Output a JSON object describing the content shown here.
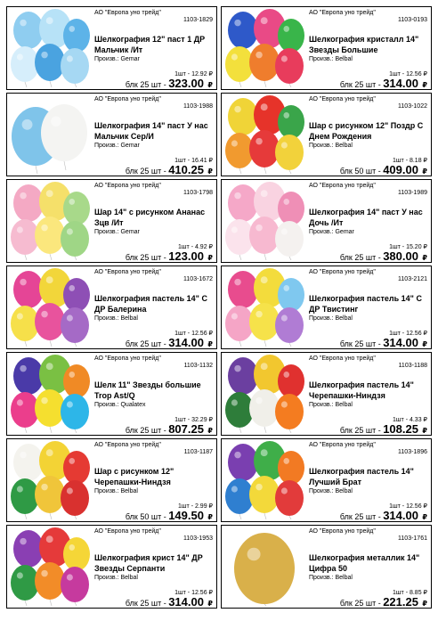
{
  "items": [
    {
      "supplier": "АО \"Европа уно трейд\"",
      "code": "1103-1829",
      "name": "Шелкография 12\" паст 1 ДР Мальчик /Ит",
      "country": "Произв.: Gemar",
      "unit": "1шт - 12.92 ₽",
      "qty": "блк 25 шт - ",
      "total": "323.00",
      "cur": "₽",
      "icon": "balloons-number-one-icon",
      "colors": [
        "#8fcdf0",
        "#b7e2f7",
        "#5db3e8",
        "#d6eefb",
        "#4aa3e0",
        "#a6d8f3"
      ]
    },
    {
      "supplier": "АО \"Европа уно трейд\"",
      "code": "1103-0193",
      "name": "Шелкография кристалл 14\" Звезды Большие",
      "country": "Произв.: Belbal",
      "unit": "1шт - 12.56 ₽",
      "qty": "блк 25 шт - ",
      "total": "314.00",
      "cur": "₽",
      "icon": "balloons-stars-icon",
      "colors": [
        "#2e59c9",
        "#e94a86",
        "#39b54a",
        "#f3e03c",
        "#ef7d2d",
        "#e83c5c"
      ]
    },
    {
      "supplier": "АО \"Европа уно трейд\"",
      "code": "1103-1988",
      "name": "Шелкография 14\" паст У нас Мальчик Сер/И",
      "country": "Произв.: Gemar",
      "unit": "1шт - 16.41 ₽",
      "qty": "блк 25 шт - ",
      "total": "410.25",
      "cur": "₽",
      "icon": "balloons-heart-icon",
      "colors": [
        "#7fc4ea",
        "#f4f4f2"
      ]
    },
    {
      "supplier": "АО \"Европа уно трейд\"",
      "code": "1103-1022",
      "name": "Шар с рисунком 12\" Поздр С Днем Рождения",
      "country": "Произв.: Belbal",
      "unit": "1шт - 8.18 ₽",
      "qty": "блк 50 шт - ",
      "total": "409.00",
      "cur": "₽",
      "icon": "balloons-birthday-icon",
      "colors": [
        "#f0d437",
        "#e6332a",
        "#3aa54a",
        "#f19a2f",
        "#e63a3a",
        "#f2d23b"
      ]
    },
    {
      "supplier": "АО \"Европа уно трейд\"",
      "code": "1103-1798",
      "name": "Шар 14\" с рисунком Ананас Зцв /Ит",
      "country": "Произв.: Gemar",
      "unit": "1шт - 4.92 ₽",
      "qty": "блк 25 шт - ",
      "total": "123.00",
      "cur": "₽",
      "icon": "balloons-pineapple-icon",
      "colors": [
        "#f4a9c4",
        "#f5e06a",
        "#a8d98a",
        "#f6bbd0",
        "#fbe77d",
        "#9fd686"
      ]
    },
    {
      "supplier": "АО \"Европа уно трейд\"",
      "code": "1103-1989",
      "name": "Шелкография 14\" паст У нас Дочь /Ит",
      "country": "Произв.: Gemar",
      "unit": "1шт - 15.20 ₽",
      "qty": "блк 25 шт - ",
      "total": "380.00",
      "cur": "₽",
      "icon": "balloons-daughter-icon",
      "colors": [
        "#f5a8c8",
        "#f9d3e1",
        "#ef8fb6",
        "#fbe3ec",
        "#f7b9d0",
        "#f4f1ef"
      ]
    },
    {
      "supplier": "АО \"Европа уно трейд\"",
      "code": "1103-1672",
      "name": "Шелкография пастель 14\" С ДР Балерина",
      "country": "Произв.: Belbal",
      "unit": "1шт - 12.56 ₽",
      "qty": "блк 25 шт - ",
      "total": "314.00",
      "cur": "₽",
      "icon": "balloons-ballerina-icon",
      "colors": [
        "#e54596",
        "#f2d63a",
        "#8e4fb5",
        "#f6e04a",
        "#e8539d",
        "#a56ac6"
      ]
    },
    {
      "supplier": "АО \"Европа уно трейд\"",
      "code": "1103-2121",
      "name": "Шелкография пастель 14\" С ДР Твистинг",
      "country": "Произв.: Belbal",
      "unit": "1шт - 12.56 ₽",
      "qty": "блк 25 шт - ",
      "total": "314.00",
      "cur": "₽",
      "icon": "balloons-twisting-icon",
      "colors": [
        "#e84c8e",
        "#f3dc3c",
        "#7fc8ef",
        "#f5a5c6",
        "#f6e24a",
        "#b07cd4"
      ]
    },
    {
      "supplier": "АО \"Европа уно трейд\"",
      "code": "1103-1132",
      "name": "Шелк 11\" Звезды большие Trop Ast/Q",
      "country": "Произв.: Qualatex",
      "unit": "1шт - 32.29 ₽",
      "qty": "блк 25 шт - ",
      "total": "807.25",
      "cur": "₽",
      "icon": "balloons-tropical-stars-icon",
      "colors": [
        "#4a3aa8",
        "#7ac043",
        "#f08a25",
        "#eb3e8c",
        "#f5df2f",
        "#2db6e8"
      ]
    },
    {
      "supplier": "АО \"Европа уно трейд\"",
      "code": "1103-1188",
      "name": "Шелкография пастель 14\" Черепашки-Ниндзя",
      "country": "Произв.: Belbal",
      "unit": "1шт - 4.33 ₽",
      "qty": "блк 25 шт - ",
      "total": "108.25",
      "cur": "₽",
      "icon": "balloons-ninja-turtles-icon",
      "colors": [
        "#6b3fa0",
        "#f2c72f",
        "#e0312f",
        "#2e7d3a",
        "#f0efe9",
        "#f47c20"
      ]
    },
    {
      "supplier": "АО \"Европа уно трейд\"",
      "code": "1103-1187",
      "name": "Шар с рисунком 12\" Черепашки-Ниндзя",
      "country": "Произв.: Belbal",
      "unit": "1шт - 2.99 ₽",
      "qty": "блк 50 шт - ",
      "total": "149.50",
      "cur": "₽",
      "icon": "balloons-ninja-turtles-icon",
      "colors": [
        "#f4f3ee",
        "#f3d335",
        "#e53a33",
        "#2f9a45",
        "#f0c53a",
        "#d9312f"
      ]
    },
    {
      "supplier": "АО \"Европа уно трейд\"",
      "code": "1103-1896",
      "name": "Шелкография пастель 14\" Лучший Брат",
      "country": "Произв.: Belbal",
      "unit": "1шт - 12.56 ₽",
      "qty": "блк 25 шт - ",
      "total": "314.00",
      "cur": "₽",
      "icon": "balloons-best-brother-icon",
      "colors": [
        "#7a3fb0",
        "#3fae49",
        "#f27a23",
        "#2f7fd0",
        "#f3d93a",
        "#e23b3b"
      ]
    },
    {
      "supplier": "АО \"Европа уно трейд\"",
      "code": "1103-1953",
      "name": "Шелкография крист 14\" ДР Звезды Серпанти",
      "country": "Произв.: Belbal",
      "unit": "1шт - 12.56 ₽",
      "qty": "блк 25 шт - ",
      "total": "314.00",
      "cur": "₽",
      "icon": "balloons-streamer-stars-icon",
      "colors": [
        "#8a3fb3",
        "#e53a3a",
        "#f5d637",
        "#2f9a45",
        "#f28c28",
        "#c63a9e"
      ]
    },
    {
      "supplier": "АО \"Европа уно трейд\"",
      "code": "1103-1761",
      "name": "Шелкография металлик 14\" Цифра 50",
      "country": "Произв.: Belbal",
      "unit": "1шт - 8.85 ₽",
      "qty": "блк 25 шт - ",
      "total": "221.25",
      "cur": "₽",
      "icon": "balloon-number-50-icon",
      "colors": [
        "#d9b04a",
        "#f1d98a",
        "#b98a2c"
      ]
    }
  ]
}
